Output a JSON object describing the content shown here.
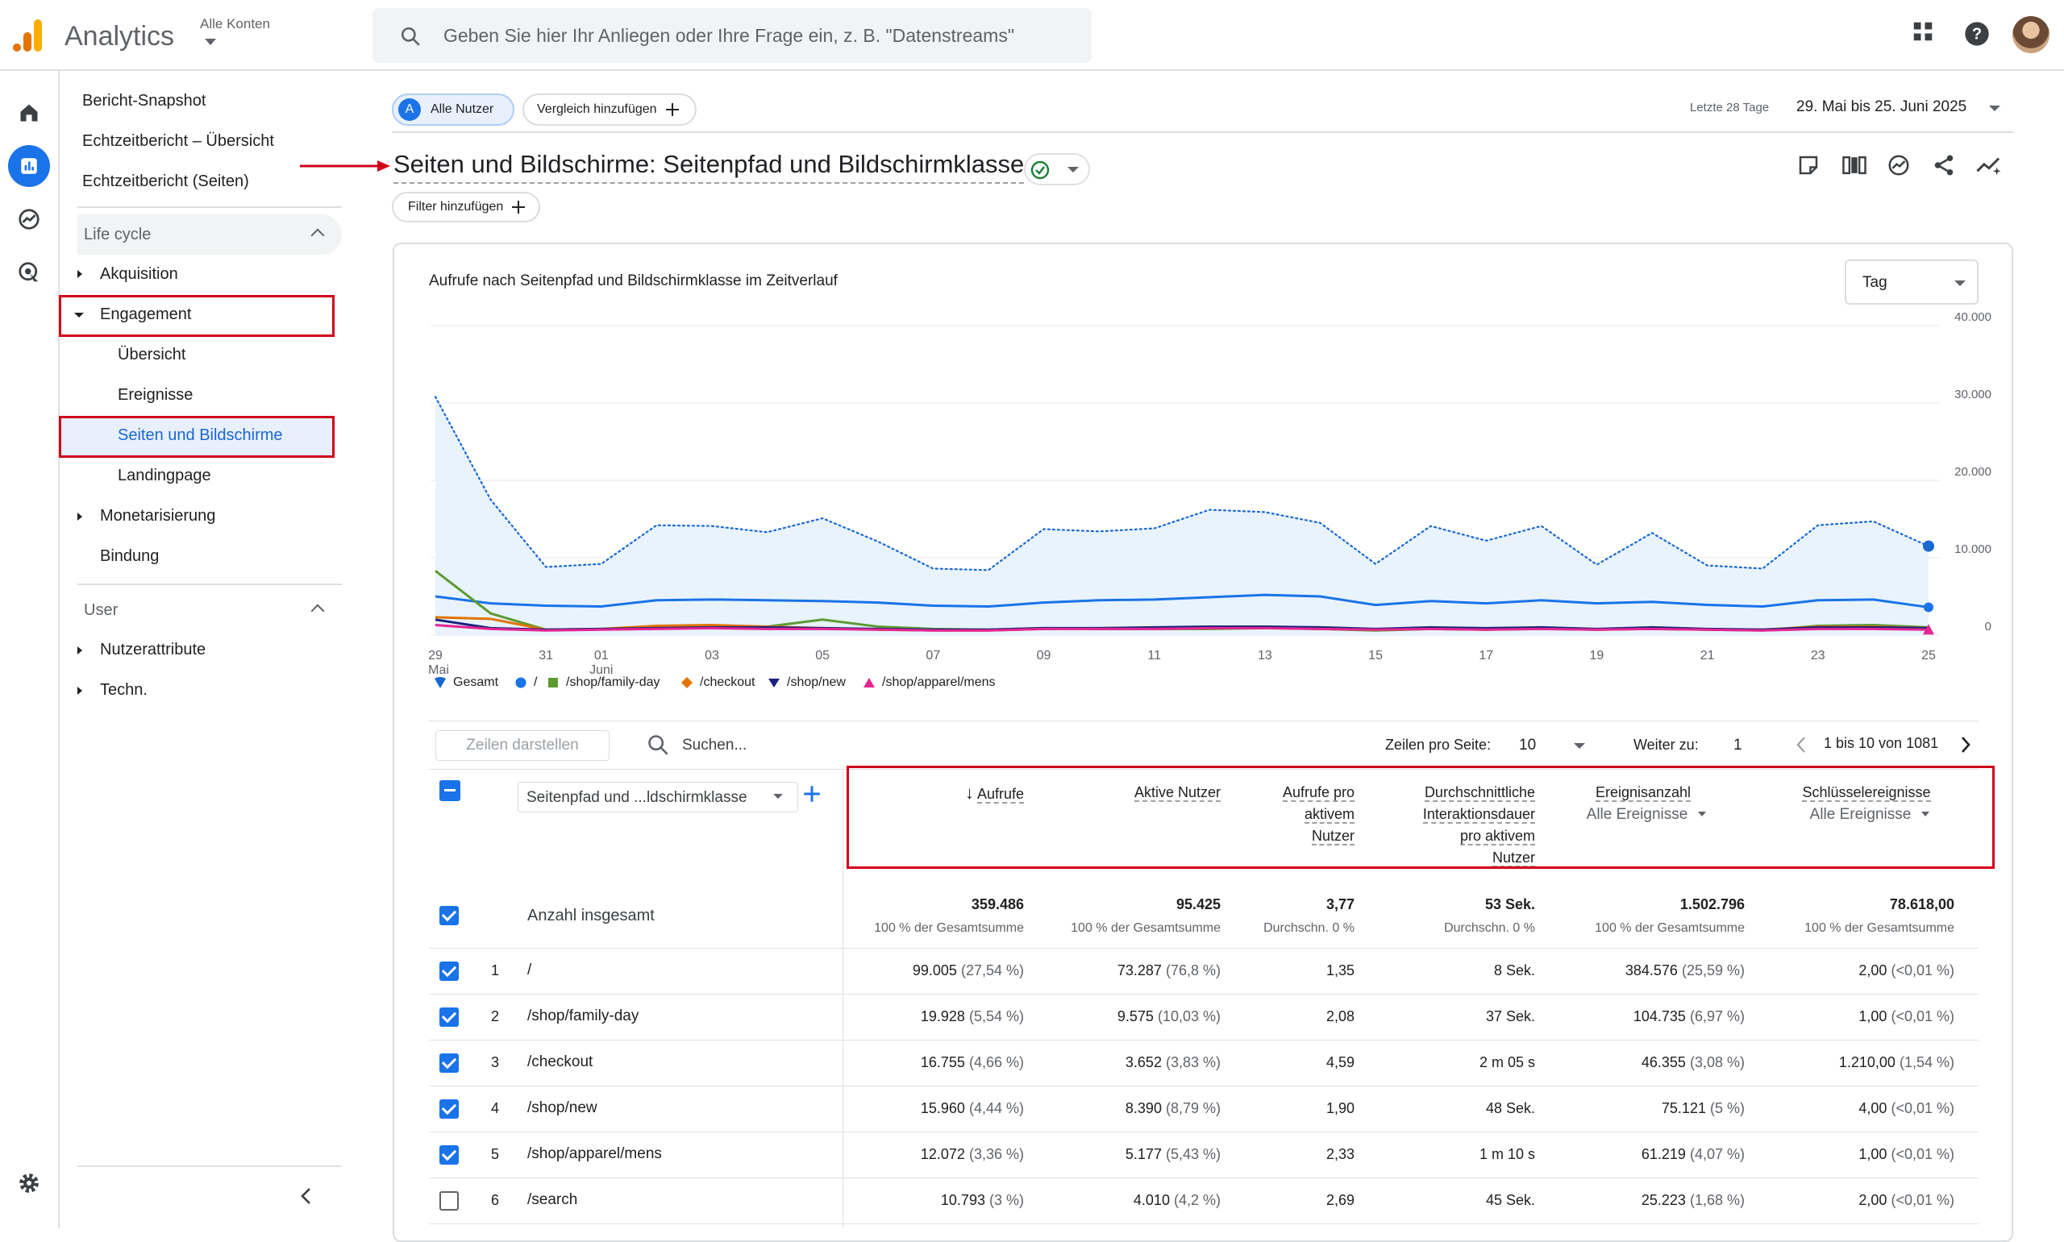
{
  "app": {
    "name": "Analytics",
    "account_label": "Alle Konten"
  },
  "search": {
    "placeholder": "Geben Sie hier Ihr Anliegen oder Ihre Frage ein, z. B. \"Datenstreams\""
  },
  "nav": {
    "top_items": [
      "Bericht-Snapshot",
      "Echtzeitbericht – Übersicht",
      "Echtzeitbericht (Seiten)"
    ],
    "lifecycle_header": "Life cycle",
    "acquisition": "Akquisition",
    "engagement": "Engagement",
    "engagement_children": [
      "Übersicht",
      "Ereignisse",
      "Seiten und Bildschirme",
      "Landingpage"
    ],
    "monetization": "Monetarisierung",
    "retention": "Bindung",
    "user_header": "User",
    "user_attributes": "Nutzerattribute",
    "tech": "Techn."
  },
  "header": {
    "all_users_chip": "Alle Nutzer",
    "all_users_avatar": "A",
    "compare_chip": "Vergleich hinzufügen",
    "date_label": "Letzte 28 Tage",
    "date_range": "29. Mai bis 25. Juni 2025",
    "title": "Seiten und Bildschirme: Seitenpfad und Bildschirmklasse",
    "filter_chip": "Filter hinzufügen"
  },
  "chart": {
    "title": "Aufrufe nach Seitenpfad und Bildschirmklasse im Zeitverlauf",
    "granularity": "Tag"
  },
  "chart_data": {
    "type": "line",
    "x": [
      "29 Mai",
      "30",
      "31",
      "01 Juni",
      "02",
      "03",
      "04",
      "05",
      "06",
      "07",
      "08",
      "09",
      "10",
      "11",
      "12",
      "13",
      "14",
      "15",
      "16",
      "17",
      "18",
      "19",
      "20",
      "21",
      "22",
      "23",
      "24",
      "25"
    ],
    "x_tick_labels": [
      "29",
      "31",
      "01",
      "03",
      "05",
      "07",
      "09",
      "11",
      "13",
      "15",
      "17",
      "19",
      "21",
      "23",
      "25"
    ],
    "x_tick_sublabels": {
      "29": "Mai",
      "01": "Juni"
    },
    "y_tick_labels": [
      "40.000",
      "30.000",
      "20.000",
      "10.000",
      "0"
    ],
    "ylim": [
      0,
      40000
    ],
    "series": [
      {
        "name": "Gesamt",
        "color": "#1967d2",
        "style": "dotted-area",
        "values": [
          30800,
          17500,
          8800,
          9200,
          14200,
          14100,
          13300,
          15100,
          12100,
          8600,
          8400,
          13700,
          13400,
          13800,
          16200,
          15900,
          14500,
          9200,
          14100,
          12200,
          14100,
          9100,
          13200,
          9000,
          8600,
          14200,
          14700,
          11500
        ]
      },
      {
        "name": "/",
        "color": "#1a73e8",
        "values": [
          5000,
          4100,
          3800,
          3700,
          4500,
          4600,
          4500,
          4400,
          4200,
          3800,
          3700,
          4200,
          4500,
          4600,
          4900,
          5200,
          5000,
          3900,
          4400,
          4100,
          4500,
          4100,
          4300,
          3900,
          3700,
          4500,
          4600,
          3600
        ]
      },
      {
        "name": "/shop/family-day",
        "color": "#5c9a32",
        "values": [
          8300,
          2800,
          700,
          800,
          1000,
          1200,
          1100,
          2000,
          1100,
          800,
          700,
          900,
          800,
          800,
          800,
          900,
          800,
          600,
          800,
          700,
          800,
          700,
          900,
          700,
          600,
          1200,
          1300,
          1000
        ]
      },
      {
        "name": "/checkout",
        "color": "#e37400",
        "values": [
          2300,
          2100,
          700,
          800,
          1200,
          1300,
          1100,
          900,
          700,
          600,
          600,
          800,
          900,
          900,
          900,
          1000,
          800,
          700,
          800,
          700,
          900,
          700,
          800,
          700,
          700,
          1100,
          1100,
          900
        ]
      },
      {
        "name": "/shop/new",
        "color": "#1a237e",
        "values": [
          2000,
          900,
          700,
          800,
          900,
          1000,
          1000,
          900,
          800,
          700,
          700,
          900,
          900,
          1000,
          1100,
          1100,
          1000,
          800,
          1000,
          900,
          1000,
          800,
          1000,
          800,
          700,
          1000,
          1000,
          900
        ]
      },
      {
        "name": "/shop/apparel/mens",
        "color": "#e52592",
        "values": [
          1300,
          800,
          600,
          700,
          800,
          900,
          800,
          800,
          700,
          600,
          600,
          800,
          800,
          800,
          900,
          900,
          800,
          700,
          800,
          700,
          800,
          700,
          800,
          700,
          600,
          800,
          800,
          700
        ]
      }
    ]
  },
  "table": {
    "show_rows_placeholder": "Zeilen darstellen",
    "search_placeholder": "Suchen...",
    "rows_per_page_label": "Zeilen pro Seite:",
    "rows_per_page": "10",
    "goto_label": "Weiter zu:",
    "goto_value": "1",
    "pagination": "1 bis 10 von 1081",
    "dimension": "Seitenpfad und ...ldschirmklasse",
    "columns": {
      "views": "Aufrufe",
      "active_users": "Aktive Nutzer",
      "views_per_user": [
        "Aufrufe pro",
        "aktivem",
        "Nutzer"
      ],
      "avg_engagement": [
        "Durchschnittliche",
        "Interaktionsdauer",
        "pro aktivem",
        "Nutzer"
      ],
      "event_count": "Ereignisanzahl",
      "event_count_filter": "Alle Ereignisse",
      "key_events": "Schlüsselereignisse",
      "key_events_filter": "Alle Ereignisse"
    },
    "totals": {
      "label": "Anzahl insgesamt",
      "views": "359.486",
      "views_sub": "100 % der Gesamtsumme",
      "active_users": "95.425",
      "active_users_sub": "100 % der Gesamtsumme",
      "views_per_user": "3,77",
      "views_per_user_sub": "Durchschn. 0 %",
      "avg_engagement": "53 Sek.",
      "avg_engagement_sub": "Durchschn. 0 %",
      "event_count": "1.502.796",
      "event_count_sub": "100 % der Gesamtsumme",
      "key_events": "78.618,00",
      "key_events_sub": "100 % der Gesamtsumme"
    },
    "rows": [
      {
        "n": "1",
        "path": "/",
        "views": "99.005",
        "views_p": "(27,54 %)",
        "users": "73.287",
        "users_p": "(76,8 %)",
        "vpu": "1,35",
        "eng": "8 Sek.",
        "events": "384.576",
        "events_p": "(25,59 %)",
        "key": "2,00",
        "key_p": "(<0,01 %)",
        "checked": true
      },
      {
        "n": "2",
        "path": "/shop/family-day",
        "views": "19.928",
        "views_p": "(5,54 %)",
        "users": "9.575",
        "users_p": "(10,03 %)",
        "vpu": "2,08",
        "eng": "37 Sek.",
        "events": "104.735",
        "events_p": "(6,97 %)",
        "key": "1,00",
        "key_p": "(<0,01 %)",
        "checked": true
      },
      {
        "n": "3",
        "path": "/checkout",
        "views": "16.755",
        "views_p": "(4,66 %)",
        "users": "3.652",
        "users_p": "(3,83 %)",
        "vpu": "4,59",
        "eng": "2 m 05 s",
        "events": "46.355",
        "events_p": "(3,08 %)",
        "key": "1.210,00",
        "key_p": "(1,54 %)",
        "checked": true
      },
      {
        "n": "4",
        "path": "/shop/new",
        "views": "15.960",
        "views_p": "(4,44 %)",
        "users": "8.390",
        "users_p": "(8,79 %)",
        "vpu": "1,90",
        "eng": "48 Sek.",
        "events": "75.121",
        "events_p": "(5 %)",
        "key": "4,00",
        "key_p": "(<0,01 %)",
        "checked": true
      },
      {
        "n": "5",
        "path": "/shop/apparel/mens",
        "views": "12.072",
        "views_p": "(3,36 %)",
        "users": "5.177",
        "users_p": "(5,43 %)",
        "vpu": "2,33",
        "eng": "1 m 10 s",
        "events": "61.219",
        "events_p": "(4,07 %)",
        "key": "1,00",
        "key_p": "(<0,01 %)",
        "checked": true
      },
      {
        "n": "6",
        "path": "/search",
        "views": "10.793",
        "views_p": "(3 %)",
        "users": "4.010",
        "users_p": "(4,2 %)",
        "vpu": "2,69",
        "eng": "45 Sek.",
        "events": "25.223",
        "events_p": "(1,68 %)",
        "key": "2,00",
        "key_p": "(<0,01 %)",
        "checked": false
      }
    ]
  }
}
